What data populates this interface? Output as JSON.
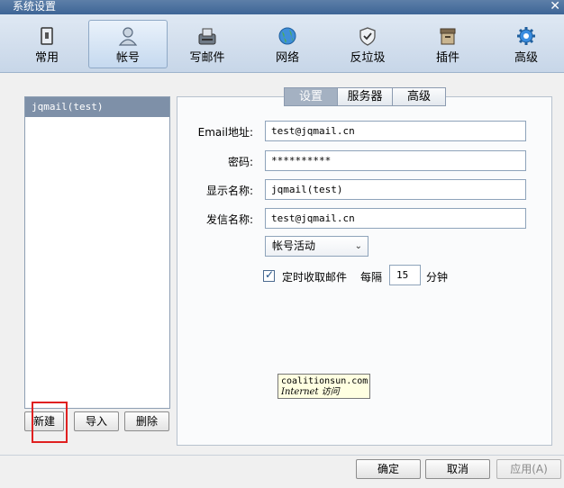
{
  "window": {
    "title": "系统设置",
    "close_glyph": "✕"
  },
  "toolbar": {
    "items": [
      {
        "label": "常用",
        "icon": "general-icon"
      },
      {
        "label": "帐号",
        "icon": "account-icon",
        "active": true
      },
      {
        "label": "写邮件",
        "icon": "compose-icon"
      },
      {
        "label": "网络",
        "icon": "network-icon"
      },
      {
        "label": "反垃圾",
        "icon": "antispam-icon"
      },
      {
        "label": "插件",
        "icon": "plugin-icon"
      },
      {
        "label": "高级",
        "icon": "advanced-gear-icon"
      }
    ]
  },
  "accounts": {
    "items": [
      "jqmail(test)"
    ],
    "selected": "jqmail(test)"
  },
  "account_buttons": {
    "new": "新建",
    "import": "导入",
    "delete": "删除"
  },
  "tabs": {
    "items": [
      "设置",
      "服务器",
      "高级"
    ],
    "active": "设置"
  },
  "form": {
    "email_label": "Email地址:",
    "email_value": "test@jqmail.cn",
    "password_label": "密码:",
    "password_value": "**********",
    "display_name_label": "显示名称:",
    "display_name_value": "jqmail(test)",
    "sender_name_label": "发信名称:",
    "sender_name_value": "test@jqmail.cn",
    "status_select": "帐号活动",
    "auto_check_label": "定时收取邮件",
    "auto_check_checked": true,
    "interval_label": "每隔",
    "interval_value": "15",
    "interval_unit": "分钟"
  },
  "watermark": {
    "line1": "coalitionsun.com",
    "line2": "Internet 访问"
  },
  "footer": {
    "ok": "确定",
    "cancel": "取消",
    "apply": "应用(A)"
  },
  "colors": {
    "accent": "#3e6596",
    "highlight": "#e02020",
    "selection": "#7e90a8"
  }
}
